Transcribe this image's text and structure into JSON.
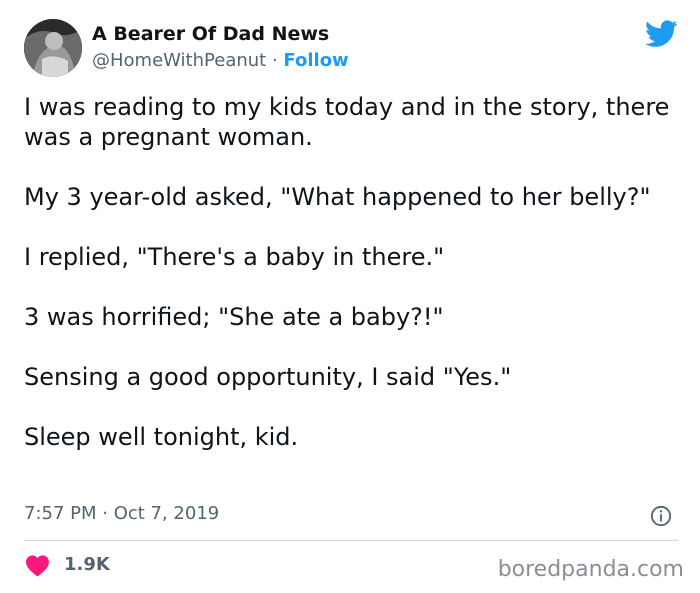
{
  "author": {
    "display_name": "A Bearer Of Dad News",
    "handle": "@HomeWithPeanut",
    "separator": "·",
    "follow_label": "Follow"
  },
  "icons": {
    "platform": "twitter-bird-icon",
    "info": "info-icon",
    "like": "heart-icon"
  },
  "colors": {
    "accent": "#1d9bf0",
    "like": "#f91880",
    "muted": "#536471"
  },
  "tweet": {
    "paragraphs": [
      "I was reading to my kids today and in the story, there was a pregnant woman.",
      "My 3 year-old asked, \"What happened to her belly?\"",
      "I replied, \"There's a baby in there.\"",
      "3 was horrified; \"She ate a baby?!\"",
      "Sensing a good opportunity, I said \"Yes.\"",
      "Sleep well tonight, kid."
    ],
    "timestamp": "7:57 PM · Oct 7, 2019"
  },
  "engagement": {
    "likes": "1.9K"
  },
  "watermark": "boredpanda.com"
}
